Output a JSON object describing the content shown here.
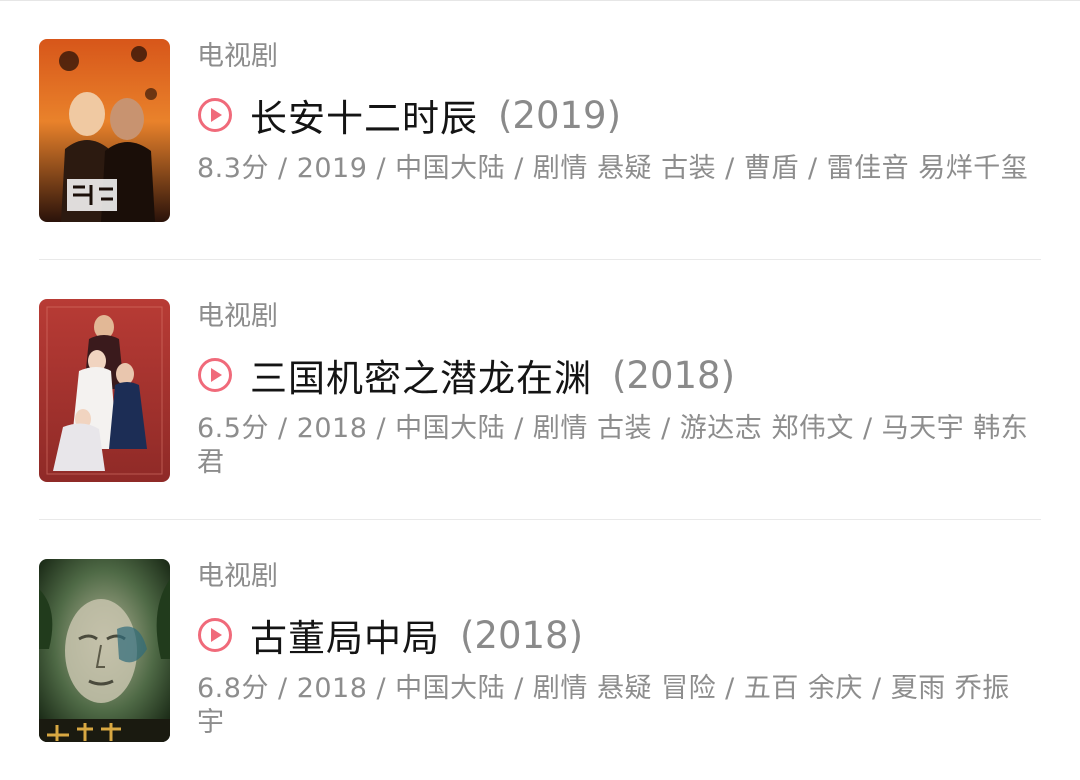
{
  "items": [
    {
      "category": "电视剧",
      "title": "长安十二时辰",
      "year": "(2019)",
      "meta": "8.3分 / 2019 / 中国大陆 / 剧情 悬疑 古装 / 曹盾 / 雷佳音 易烊千玺",
      "poster_icon": "poster-image"
    },
    {
      "category": "电视剧",
      "title": "三国机密之潜龙在渊",
      "year": "(2018)",
      "meta": "6.5分 / 2018 / 中国大陆 / 剧情 古装 / 游达志 郑伟文 / 马天宇 韩东君",
      "poster_icon": "poster-image"
    },
    {
      "category": "电视剧",
      "title": "古董局中局",
      "year": "(2018)",
      "meta": "6.8分 / 2018 / 中国大陆 / 剧情 悬疑 冒险 / 五百 余庆 / 夏雨 乔振宇",
      "poster_icon": "poster-image"
    }
  ],
  "colors": {
    "play_icon": "#f06a7a",
    "title": "#141414",
    "secondary": "#8d8d8d",
    "divider": "#e9e9e9"
  },
  "icons": {
    "play": "play-circle-icon"
  }
}
